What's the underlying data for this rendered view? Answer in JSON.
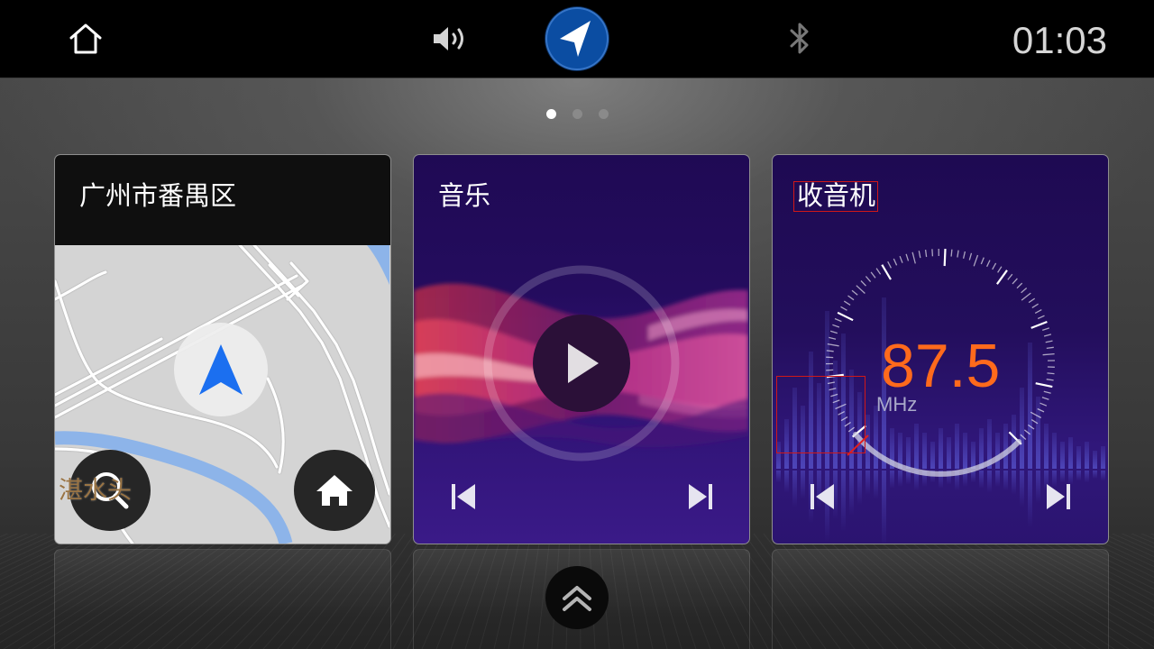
{
  "status_bar": {
    "home_icon": "home-icon",
    "volume_icon": "volume-icon",
    "navigation_icon": "navigation-arrow-icon",
    "bluetooth_icon": "bluetooth-icon",
    "time": "01:03"
  },
  "pager": {
    "page_count": 3,
    "active_page": 1
  },
  "cards": {
    "map": {
      "title": "广州市番禺区",
      "place_label": "湛水头",
      "location_icon": "location-arrow-icon",
      "search_icon": "search-icon",
      "home_icon": "home-icon"
    },
    "music": {
      "title": "音乐",
      "play_icon": "play-icon",
      "previous_icon": "skip-previous-icon",
      "next_icon": "skip-next-icon"
    },
    "radio": {
      "title": "收音机",
      "frequency": "87.5",
      "unit": "MHz",
      "previous_icon": "skip-previous-icon",
      "next_icon": "skip-next-icon"
    }
  },
  "bottom": {
    "expand_icon": "double-chevron-up-icon"
  },
  "colors": {
    "navigation_button": "#0b4da2",
    "location_arrow": "#1b6ff0",
    "frequency": "#ff6a1c",
    "radio_needle": "#e01f1f",
    "active_dot": "#ffffff",
    "inactive_dot": "#8a8a8a"
  }
}
